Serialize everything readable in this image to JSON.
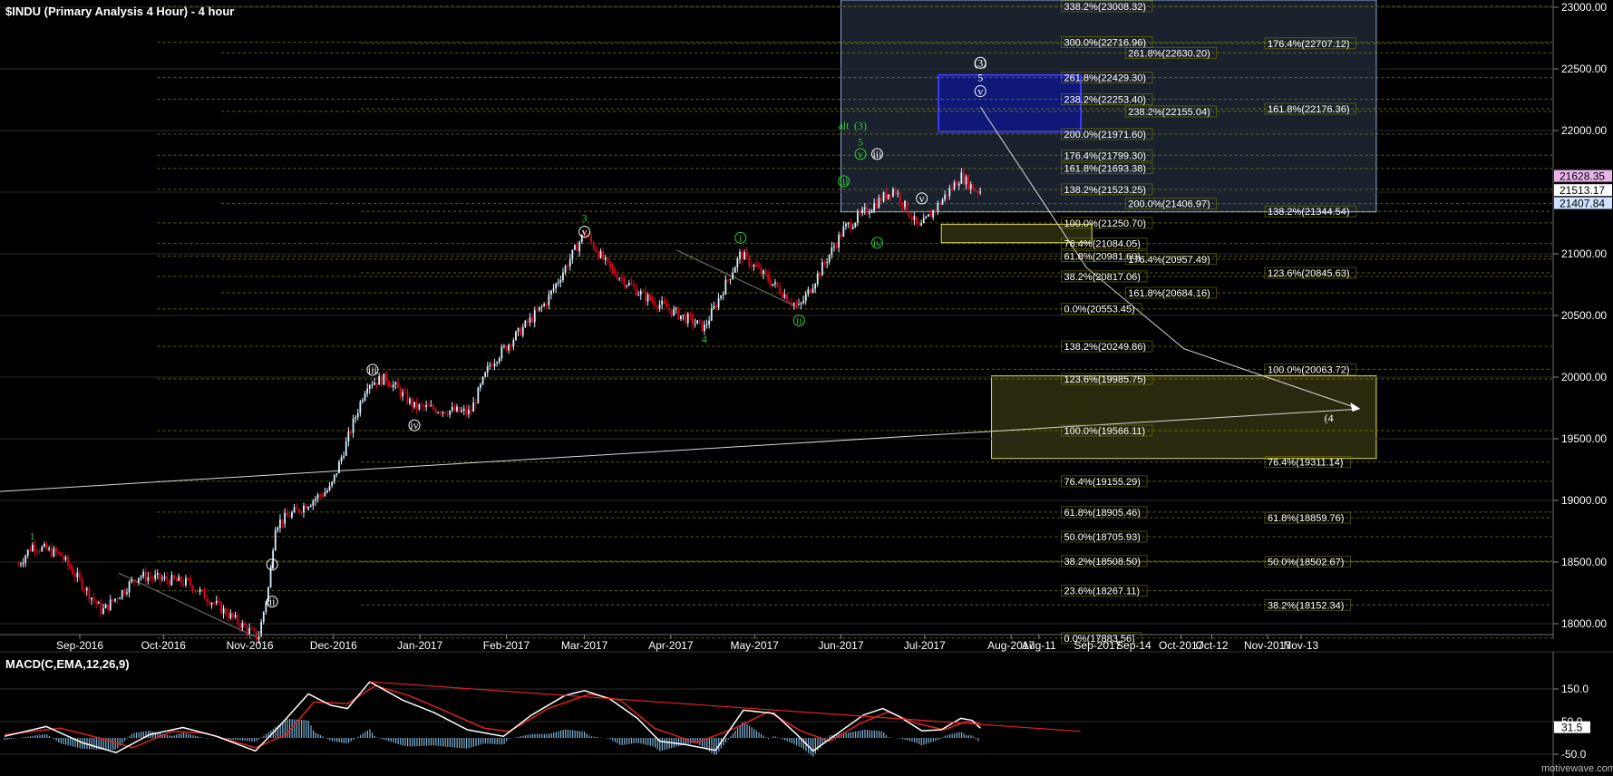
{
  "chart": {
    "title": "$INDU (Primary Analysis 4 Hour) - 4 hour",
    "watermark": "motivewave.com",
    "colors": {
      "background": "#000000",
      "grid": "#b4b400",
      "candle_up": "#d8f0ff",
      "candle_down": "#e8001a",
      "wave_green": "#33cc33",
      "wave_white": "#ffffff",
      "projection_box_fill": "#1c2532",
      "projection_box_stroke": "#8aa8d0",
      "target_blue": "#1a1ad6",
      "support_box_stroke": "#e0e060",
      "support_box_fill": "#2e2e10",
      "macd_line": "#ffffff",
      "signal_line": "#dd2222",
      "histogram": "#7fb3d5",
      "trendline": "#dd2222"
    }
  },
  "chart_data": [
    {
      "type": "candlestick",
      "title": "$INDU (Primary Analysis 4 Hour) - 4 hour",
      "timeframe": "4 hour",
      "ylim": [
        17800,
        23050
      ],
      "yticks": [
        "23000.00",
        "22500.00",
        "22000.00",
        "21500.00",
        "21000.00",
        "20500.00",
        "20000.00",
        "19500.00",
        "19000.00",
        "18500.00",
        "18000.00"
      ],
      "xticks": [
        "Sep-2016",
        "Oct-2016",
        "Nov-2016",
        "Dec-2016",
        "Jan-2017",
        "Feb-2017",
        "Mar-2017",
        "Apr-2017",
        "May-2017",
        "Jun-2017",
        "Jul-2017",
        "Aug-2017",
        "Aug-11",
        "Sep-2017",
        "Sep-14",
        "Oct-2017",
        "Oct-12",
        "Nov-2017",
        "Nov-13"
      ],
      "price_path": [
        {
          "date": "2016-08-10",
          "price": 18480
        },
        {
          "date": "2016-08-15",
          "price": 18636
        },
        {
          "date": "2016-08-25",
          "price": 18560
        },
        {
          "date": "2016-09-09",
          "price": 18100
        },
        {
          "date": "2016-09-22",
          "price": 18390
        },
        {
          "date": "2016-10-10",
          "price": 18330
        },
        {
          "date": "2016-11-04",
          "price": 17883
        },
        {
          "date": "2016-11-08",
          "price": 18330
        },
        {
          "date": "2016-11-10",
          "price": 18800
        },
        {
          "date": "2016-11-30",
          "price": 19100
        },
        {
          "date": "2016-12-13",
          "price": 19950
        },
        {
          "date": "2016-12-20",
          "price": 19990
        },
        {
          "date": "2016-12-30",
          "price": 19760
        },
        {
          "date": "2017-01-19",
          "price": 19710
        },
        {
          "date": "2017-01-26",
          "price": 20100
        },
        {
          "date": "2017-02-15",
          "price": 20600
        },
        {
          "date": "2017-03-01",
          "price": 21170
        },
        {
          "date": "2017-03-10",
          "price": 20880
        },
        {
          "date": "2017-03-22",
          "price": 20660
        },
        {
          "date": "2017-04-13",
          "price": 20400
        },
        {
          "date": "2017-04-26",
          "price": 21000
        },
        {
          "date": "2017-05-17",
          "price": 20560
        },
        {
          "date": "2017-06-02",
          "price": 21200
        },
        {
          "date": "2017-06-20",
          "price": 21530
        },
        {
          "date": "2017-06-29",
          "price": 21200
        },
        {
          "date": "2017-07-14",
          "price": 21630
        },
        {
          "date": "2017-07-19",
          "price": 21520
        },
        {
          "date": "2017-07-21",
          "price": 21513
        }
      ],
      "price_tags": [
        {
          "label": "21628.35",
          "value": 21628.35,
          "color": "#e8b4e8"
        },
        {
          "label": "21513.17",
          "value": 21513.17,
          "color": "#ffffff"
        },
        {
          "label": "21407.84",
          "value": 21407.84,
          "color": "#cfe2ff"
        }
      ],
      "wave_labels": [
        {
          "text": "1",
          "date": "2016-08-15",
          "price": 18680,
          "color": "green"
        },
        {
          "text": "i",
          "date": "2016-11-09",
          "price": 18450,
          "color": "white",
          "circled": true
        },
        {
          "text": "ii",
          "date": "2016-11-09",
          "price": 18150,
          "color": "white",
          "circled": true
        },
        {
          "text": "iii",
          "date": "2016-12-15",
          "price": 20030,
          "color": "white",
          "circled": true
        },
        {
          "text": "iv",
          "date": "2016-12-30",
          "price": 19580,
          "color": "white",
          "circled": true
        },
        {
          "text": "3",
          "date": "2017-03-01",
          "price": 21260,
          "color": "green"
        },
        {
          "text": "v",
          "date": "2017-03-01",
          "price": 21150,
          "color": "white",
          "circled": true
        },
        {
          "text": "4",
          "date": "2017-04-13",
          "price": 20280,
          "color": "green"
        },
        {
          "text": "i",
          "date": "2017-04-26",
          "price": 21100,
          "color": "green",
          "circled": true
        },
        {
          "text": "ii",
          "date": "2017-05-17",
          "price": 20430,
          "color": "green",
          "circled": true
        },
        {
          "text": "iii",
          "date": "2017-06-02",
          "price": 21560,
          "color": "green",
          "circled": true
        },
        {
          "text": "iv",
          "date": "2017-06-14",
          "price": 21060,
          "color": "green",
          "circled": true
        },
        {
          "text": "v",
          "date": "2017-06-30",
          "price": 21420,
          "color": "white",
          "circled": true
        },
        {
          "text": "alt",
          "date": "2017-06-02",
          "price": 22010,
          "color": "green"
        },
        {
          "text": "(3)",
          "date": "2017-06-08",
          "price": 22010,
          "color": "green"
        },
        {
          "text": "5",
          "date": "2017-06-08",
          "price": 21880,
          "color": "green"
        },
        {
          "text": "v",
          "date": "2017-06-08",
          "price": 21780,
          "color": "green",
          "circled": true
        },
        {
          "text": "iii",
          "date": "2017-06-14",
          "price": 21780,
          "color": "white",
          "circled": true
        },
        {
          "text": "(3)",
          "date": "2017-07-21",
          "price": 22520,
          "color": "white",
          "circled": true
        },
        {
          "text": "5",
          "date": "2017-07-21",
          "price": 22400,
          "color": "white"
        },
        {
          "text": "v",
          "date": "2017-07-21",
          "price": 22290,
          "color": "white",
          "circled": true
        },
        {
          "text": "(4",
          "date": "2017-11-23",
          "price": 19640,
          "color": "white"
        }
      ],
      "fib_levels": [
        {
          "label": "338.2%(23008.32)",
          "value": 23008.32,
          "date": "2017-08-20"
        },
        {
          "label": "300.0%(22716.96)",
          "value": 22716.96,
          "date": "2017-08-20"
        },
        {
          "label": "261.8%(22429.30)",
          "value": 22429.3,
          "date": "2017-08-20"
        },
        {
          "label": "238.2%(22253.40)",
          "value": 22253.4,
          "date": "2017-08-20"
        },
        {
          "label": "200.0%(21971.60)",
          "value": 21971.6,
          "date": "2017-08-20"
        },
        {
          "label": "176.4%(21799.30)",
          "value": 21799.3,
          "date": "2017-08-20"
        },
        {
          "label": "161.8%(21693.38)",
          "value": 21693.38,
          "date": "2017-08-20"
        },
        {
          "label": "138.2%(21523.25)",
          "value": 21523.25,
          "date": "2017-08-20"
        },
        {
          "label": "100.0%(21250.70)",
          "value": 21250.7,
          "date": "2017-08-20"
        },
        {
          "label": "76.4%(21084.05)",
          "value": 21084.05,
          "date": "2017-08-20"
        },
        {
          "label": "61.8%(20981.60)",
          "value": 20981.6,
          "date": "2017-08-20"
        },
        {
          "label": "38.2%(20817.06)",
          "value": 20817.06,
          "date": "2017-08-20"
        },
        {
          "label": "0.0%(20553.45)",
          "value": 20553.45,
          "date": "2017-08-20"
        },
        {
          "label": "261.8%(22630.20)",
          "value": 22630.2,
          "date": "2017-09-12"
        },
        {
          "label": "238.2%(22155.04)",
          "value": 22155.04,
          "date": "2017-09-12"
        },
        {
          "label": "200.0%(21406.97)",
          "value": 21406.97,
          "date": "2017-09-12"
        },
        {
          "label": "176.4%(20957.49)",
          "value": 20957.49,
          "date": "2017-09-12"
        },
        {
          "label": "161.8%(20684.16)",
          "value": 20684.16,
          "date": "2017-09-12"
        },
        {
          "label": "138.2%(20249.86)",
          "value": 20249.86,
          "date": "2017-08-20"
        },
        {
          "label": "123.6%(19985.75)",
          "value": 19985.75,
          "date": "2017-08-20"
        },
        {
          "label": "100.0%(19566.11)",
          "value": 19566.11,
          "date": "2017-08-20"
        },
        {
          "label": "76.4%(19155.29)",
          "value": 19155.29,
          "date": "2017-08-20"
        },
        {
          "label": "61.8%(18905.46)",
          "value": 18905.46,
          "date": "2017-08-20"
        },
        {
          "label": "50.0%(18705.93)",
          "value": 18705.93,
          "date": "2017-08-20"
        },
        {
          "label": "38.2%(18508.50)",
          "value": 18508.5,
          "date": "2017-08-20"
        },
        {
          "label": "23.6%(18267.11)",
          "value": 18267.11,
          "date": "2017-08-20"
        },
        {
          "label": "0.0%(17883.56)",
          "value": 17883.56,
          "date": "2017-08-20"
        },
        {
          "label": "176.4%(22707.12)",
          "value": 22707.12,
          "date": "2017-11-01"
        },
        {
          "label": "161.8%(22176.36)",
          "value": 22176.36,
          "date": "2017-11-01"
        },
        {
          "label": "138.2%(21344.54)",
          "value": 21344.54,
          "date": "2017-11-01"
        },
        {
          "label": "123.6%(20845.63)",
          "value": 20845.63,
          "date": "2017-11-01"
        },
        {
          "label": "100.0%(20063.72)",
          "value": 20063.72,
          "date": "2017-11-01"
        },
        {
          "label": "76.4%(19311.14)",
          "value": 19311.14,
          "date": "2017-11-01"
        },
        {
          "label": "61.8%(18859.76)",
          "value": 18859.76,
          "date": "2017-11-01"
        },
        {
          "label": "50.0%(18502.67)",
          "value": 18502.67,
          "date": "2017-11-01"
        },
        {
          "label": "38.2%(18152.34)",
          "value": 18152.34,
          "date": "2017-11-01"
        }
      ],
      "zones": [
        {
          "kind": "projection",
          "from": "2017-06-01",
          "to": "2017-12-10",
          "low": 21340,
          "high": 23100
        },
        {
          "kind": "target_blue",
          "from": "2017-07-06",
          "to": "2017-08-26",
          "low": 21990,
          "high": 22450
        },
        {
          "kind": "support_small",
          "from": "2017-07-07",
          "to": "2017-08-30",
          "low": 21090,
          "high": 21240
        },
        {
          "kind": "support_large",
          "from": "2017-07-25",
          "to": "2017-12-10",
          "low": 19340,
          "high": 20010
        }
      ],
      "lines": [
        {
          "kind": "projection_path",
          "points": [
            {
              "date": "2017-07-21",
              "price": 22190
            },
            {
              "date": "2017-08-28",
              "price": 20890
            },
            {
              "date": "2017-10-02",
              "price": 20230
            },
            {
              "date": "2017-12-03",
              "price": 19750
            }
          ]
        },
        {
          "kind": "long_trendline",
          "points": [
            {
              "date": "2016-07-25",
              "price": 19060
            },
            {
              "date": "2017-12-03",
              "price": 19740
            }
          ]
        },
        {
          "kind": "nov_dec_base",
          "points": [
            {
              "date": "2016-09-15",
              "price": 18410
            },
            {
              "date": "2016-11-04",
              "price": 17883
            }
          ]
        },
        {
          "kind": "apr_may_base",
          "points": [
            {
              "date": "2017-04-03",
              "price": 21030
            },
            {
              "date": "2017-05-17",
              "price": 20560
            }
          ]
        }
      ]
    },
    {
      "type": "line",
      "title": "MACD(C,EMA,12,26,9)",
      "ylim": [
        -60,
        185
      ],
      "yticks": [
        "150.0",
        "50.0",
        "-50.0"
      ],
      "last_value_label": "31.5",
      "macd": [
        {
          "date": "2016-08-05",
          "v": 5
        },
        {
          "date": "2016-08-20",
          "v": 35
        },
        {
          "date": "2016-09-02",
          "v": -15
        },
        {
          "date": "2016-09-14",
          "v": -45
        },
        {
          "date": "2016-09-26",
          "v": 10
        },
        {
          "date": "2016-10-08",
          "v": 32
        },
        {
          "date": "2016-10-20",
          "v": 5
        },
        {
          "date": "2016-11-03",
          "v": -40
        },
        {
          "date": "2016-11-12",
          "v": 40
        },
        {
          "date": "2016-11-22",
          "v": 135
        },
        {
          "date": "2016-11-30",
          "v": 100
        },
        {
          "date": "2016-12-06",
          "v": 90
        },
        {
          "date": "2016-12-14",
          "v": 172
        },
        {
          "date": "2016-12-26",
          "v": 115
        },
        {
          "date": "2017-01-06",
          "v": 78
        },
        {
          "date": "2017-01-18",
          "v": 25
        },
        {
          "date": "2017-01-31",
          "v": 5
        },
        {
          "date": "2017-02-10",
          "v": 70
        },
        {
          "date": "2017-02-22",
          "v": 130
        },
        {
          "date": "2017-03-01",
          "v": 145
        },
        {
          "date": "2017-03-10",
          "v": 120
        },
        {
          "date": "2017-03-20",
          "v": 60
        },
        {
          "date": "2017-03-28",
          "v": -10
        },
        {
          "date": "2017-04-06",
          "v": -20
        },
        {
          "date": "2017-04-17",
          "v": -38
        },
        {
          "date": "2017-04-27",
          "v": 85
        },
        {
          "date": "2017-05-08",
          "v": 75
        },
        {
          "date": "2017-05-16",
          "v": 12
        },
        {
          "date": "2017-05-22",
          "v": -40
        },
        {
          "date": "2017-05-31",
          "v": 15
        },
        {
          "date": "2017-06-09",
          "v": 70
        },
        {
          "date": "2017-06-16",
          "v": 90
        },
        {
          "date": "2017-06-22",
          "v": 65
        },
        {
          "date": "2017-06-30",
          "v": 22
        },
        {
          "date": "2017-07-07",
          "v": 25
        },
        {
          "date": "2017-07-14",
          "v": 60
        },
        {
          "date": "2017-07-18",
          "v": 54
        },
        {
          "date": "2017-07-21",
          "v": 30
        }
      ],
      "signal": [
        {
          "date": "2016-08-05",
          "v": 10
        },
        {
          "date": "2016-08-25",
          "v": 30
        },
        {
          "date": "2016-09-08",
          "v": 0
        },
        {
          "date": "2016-09-20",
          "v": -30
        },
        {
          "date": "2016-10-04",
          "v": 20
        },
        {
          "date": "2016-10-16",
          "v": 15
        },
        {
          "date": "2016-11-03",
          "v": -30
        },
        {
          "date": "2016-11-14",
          "v": 10
        },
        {
          "date": "2016-11-24",
          "v": 110
        },
        {
          "date": "2016-12-06",
          "v": 105
        },
        {
          "date": "2016-12-16",
          "v": 160
        },
        {
          "date": "2016-12-28",
          "v": 130
        },
        {
          "date": "2017-01-08",
          "v": 90
        },
        {
          "date": "2017-01-24",
          "v": 30
        },
        {
          "date": "2017-02-02",
          "v": 20
        },
        {
          "date": "2017-02-16",
          "v": 90
        },
        {
          "date": "2017-03-03",
          "v": 135
        },
        {
          "date": "2017-03-14",
          "v": 115
        },
        {
          "date": "2017-03-26",
          "v": 30
        },
        {
          "date": "2017-04-10",
          "v": -15
        },
        {
          "date": "2017-04-24",
          "v": 30
        },
        {
          "date": "2017-05-06",
          "v": 80
        },
        {
          "date": "2017-05-18",
          "v": 20
        },
        {
          "date": "2017-05-28",
          "v": -10
        },
        {
          "date": "2017-06-08",
          "v": 45
        },
        {
          "date": "2017-06-18",
          "v": 80
        },
        {
          "date": "2017-06-28",
          "v": 45
        },
        {
          "date": "2017-07-08",
          "v": 25
        },
        {
          "date": "2017-07-16",
          "v": 50
        },
        {
          "date": "2017-07-21",
          "v": 44
        }
      ],
      "trendline": [
        {
          "date": "2016-12-14",
          "v": 172
        },
        {
          "date": "2017-08-26",
          "v": 20
        }
      ]
    }
  ]
}
